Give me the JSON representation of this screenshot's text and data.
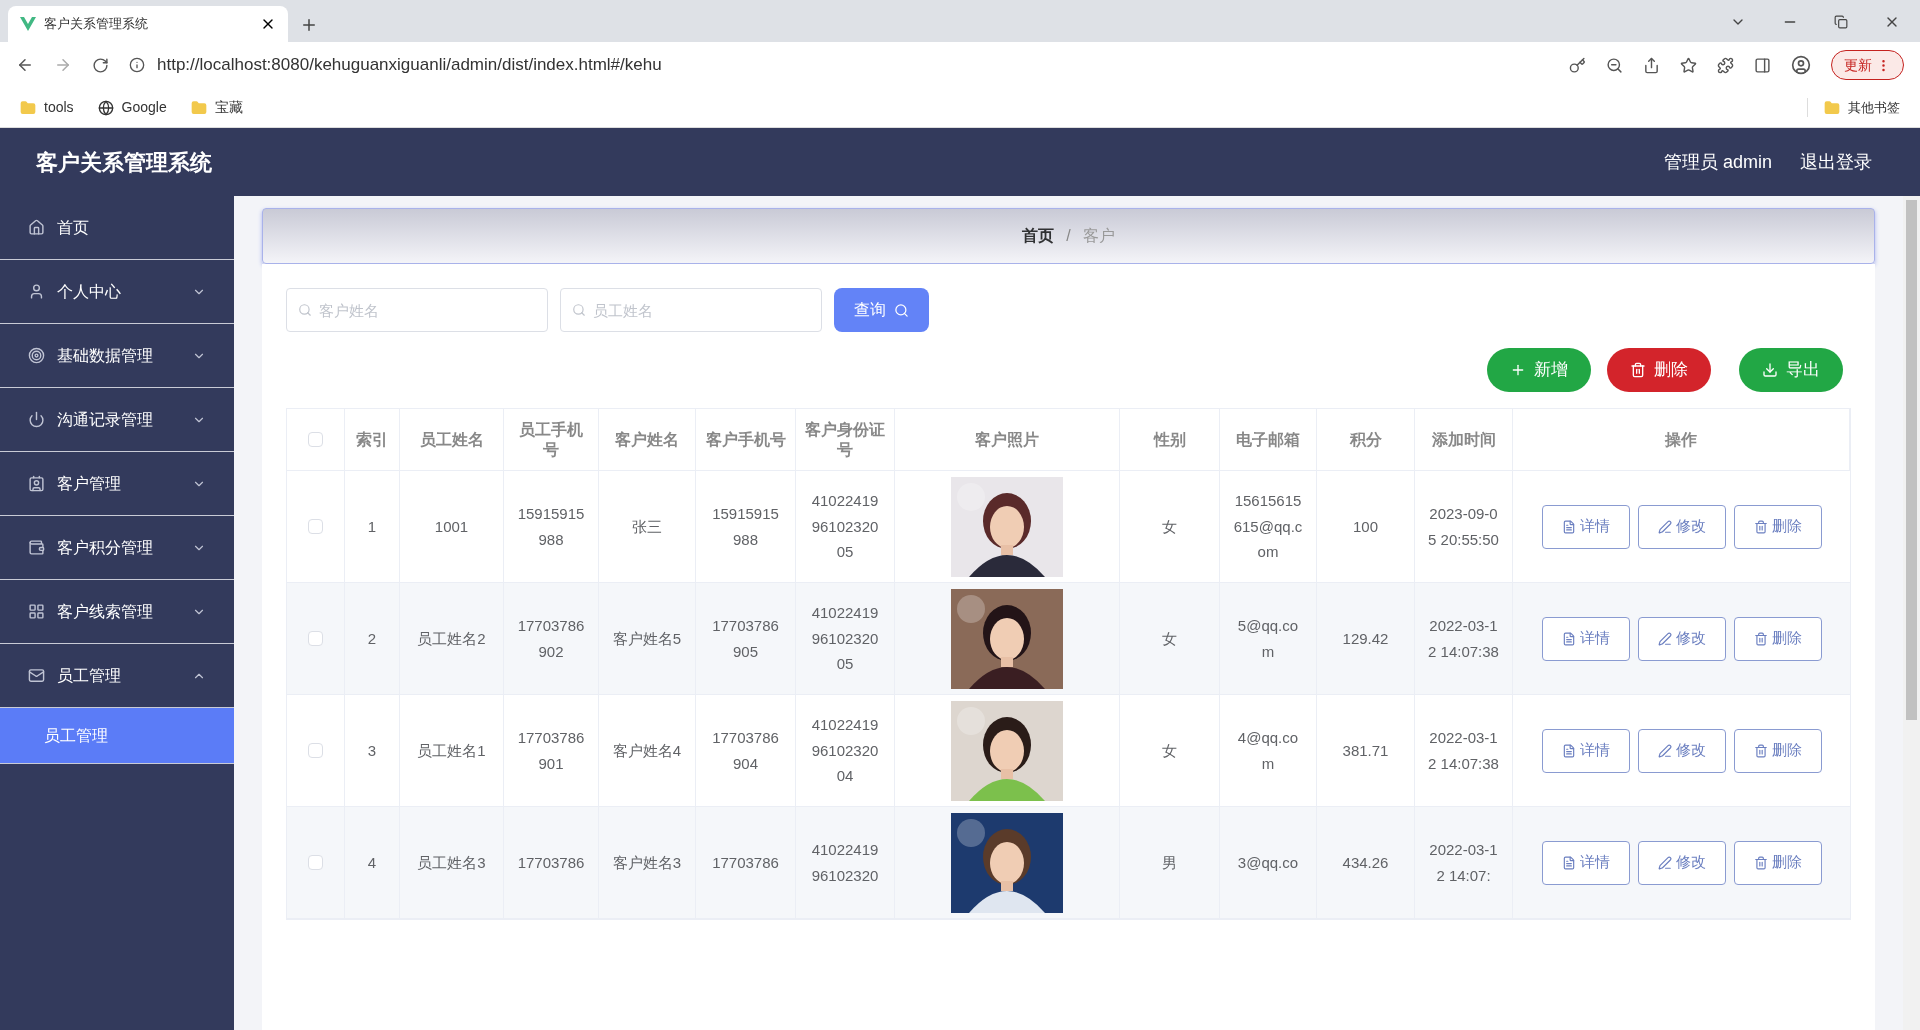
{
  "browser": {
    "tab_title": "客户关系管理系统",
    "url": "http://localhost:8080/kehuguanxiguanli/admin/dist/index.html#/kehu",
    "update_button": "更新",
    "bookmarks": [
      "tools",
      "Google",
      "宝藏"
    ],
    "other_bookmarks": "其他书签"
  },
  "header": {
    "title": "客户关系管理系统",
    "user": "管理员 admin",
    "logout": "退出登录"
  },
  "sidebar": {
    "items": [
      {
        "label": "首页",
        "has_children": false
      },
      {
        "label": "个人中心",
        "expanded": false,
        "has_children": true
      },
      {
        "label": "基础数据管理",
        "expanded": false,
        "has_children": true
      },
      {
        "label": "沟通记录管理",
        "expanded": false,
        "has_children": true
      },
      {
        "label": "客户管理",
        "expanded": false,
        "has_children": true
      },
      {
        "label": "客户积分管理",
        "expanded": false,
        "has_children": true
      },
      {
        "label": "客户线索管理",
        "expanded": false,
        "has_children": true
      },
      {
        "label": "员工管理",
        "expanded": true,
        "has_children": true,
        "children": [
          {
            "label": "员工管理",
            "selected": true
          }
        ]
      }
    ]
  },
  "breadcrumb": {
    "items": [
      "首页",
      "客户"
    ],
    "separator": "/"
  },
  "search": {
    "fields": [
      {
        "placeholder": "客户姓名"
      },
      {
        "placeholder": "员工姓名"
      }
    ],
    "button": "查询"
  },
  "actions": [
    {
      "label": "新增",
      "kind": "add"
    },
    {
      "label": "删除",
      "kind": "delete"
    },
    {
      "label": "导出",
      "kind": "export"
    }
  ],
  "table": {
    "select_all": {
      "checked": false
    },
    "columns": [
      "索引",
      "员工姓名",
      "员工手机号",
      "客户姓名",
      "客户手机号",
      "客户身份证号",
      "客户照片",
      "性别",
      "电子邮箱",
      "积分",
      "添加时间",
      "操作"
    ],
    "rows": [
      {
        "checked": false,
        "cells": [
          "1",
          "1001",
          "15915915988",
          "张三",
          "15915915988",
          "410224199610232005",
          "",
          "女",
          "15615615615@qq.com",
          "100",
          "2023-09-05 20:55:50"
        ],
        "actions": [
          "详情",
          "修改",
          "删除"
        ]
      },
      {
        "checked": false,
        "cells": [
          "2",
          "员工姓名2",
          "17703786902",
          "客户姓名5",
          "17703786905",
          "410224199610232005",
          "",
          "女",
          "5@qq.com",
          "129.42",
          "2022-03-12 14:07:38"
        ],
        "actions": [
          "详情",
          "修改",
          "删除"
        ]
      },
      {
        "checked": false,
        "cells": [
          "3",
          "员工姓名1",
          "17703786901",
          "客户姓名4",
          "17703786904",
          "410224199610232004",
          "",
          "女",
          "4@qq.com",
          "381.71",
          "2022-03-12 14:07:38"
        ],
        "actions": [
          "详情",
          "修改",
          "删除"
        ]
      },
      {
        "checked": false,
        "cells": [
          "4",
          "员工姓名3",
          "17703786",
          "客户姓名3",
          "17703786",
          "4102241996102320",
          "",
          "男",
          "3@qq.co",
          "434.26",
          "2022-03-12 14:07:"
        ],
        "actions": [
          "详情",
          "修改",
          "删除"
        ]
      }
    ]
  }
}
